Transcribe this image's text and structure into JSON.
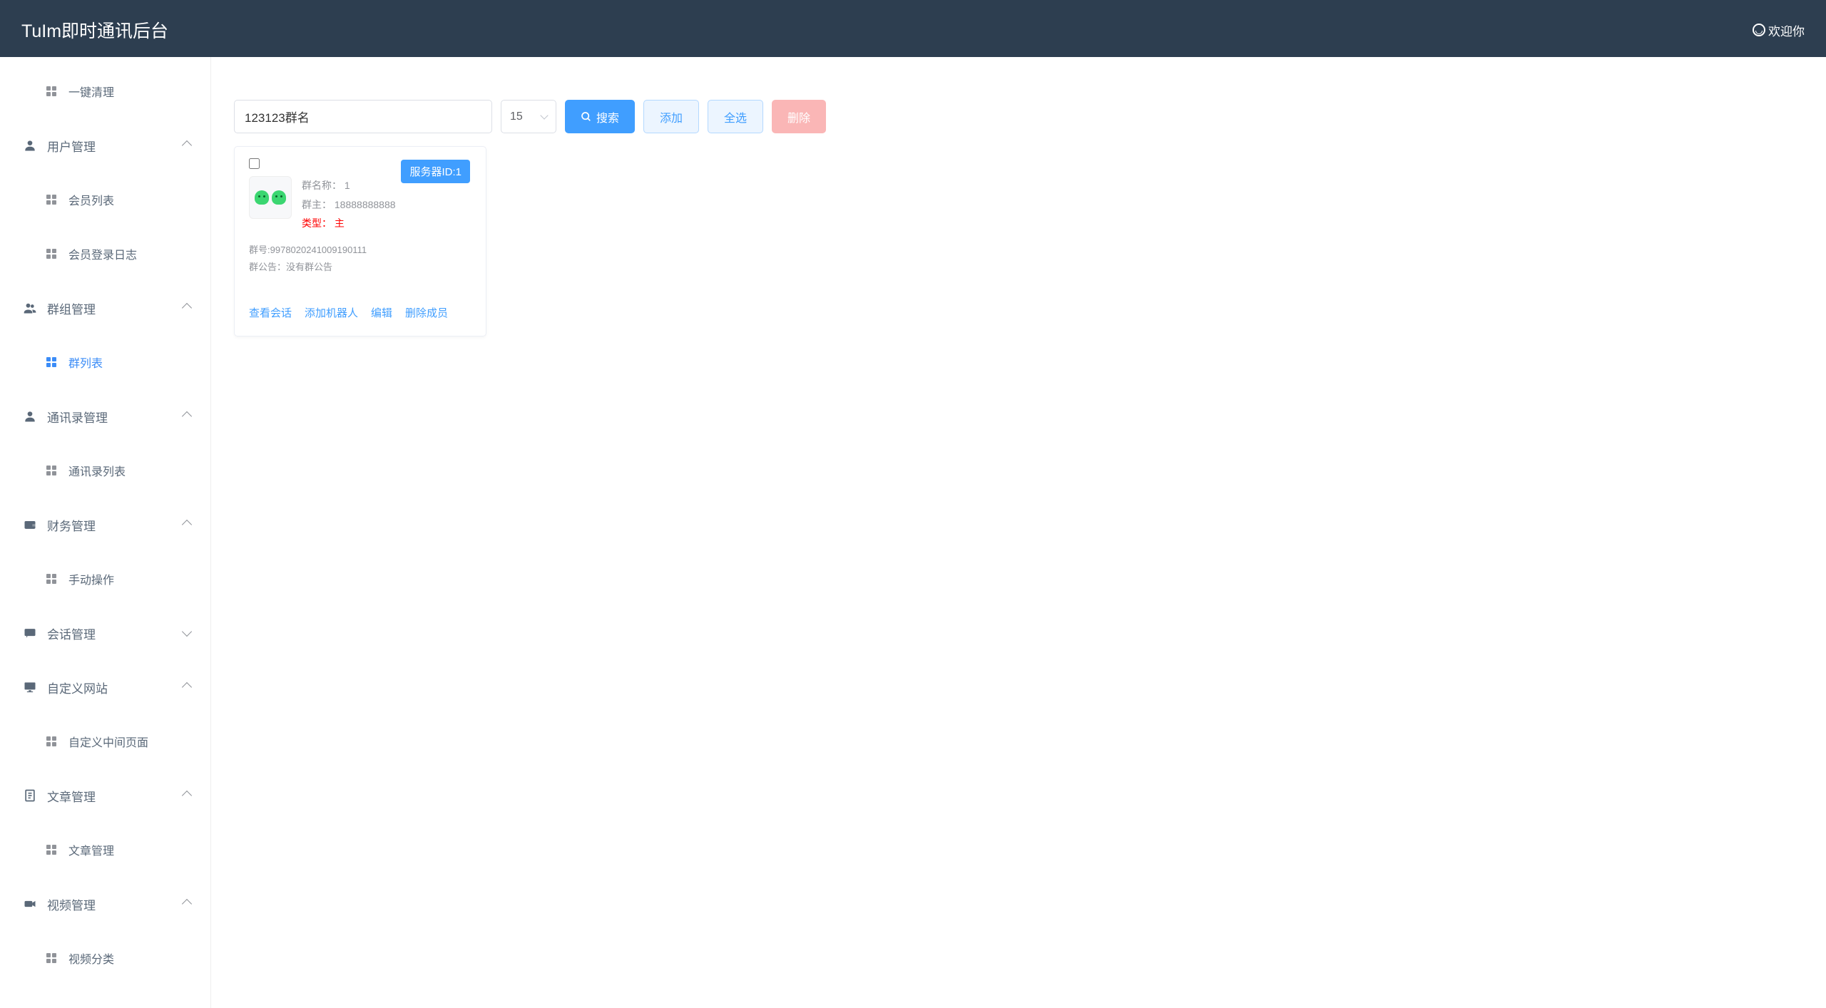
{
  "header": {
    "title": "TuIm即时通讯后台",
    "welcome": "欢迎你"
  },
  "sidebar": {
    "items": [
      {
        "label": "一键清理",
        "type": "sub",
        "icon": "grid"
      },
      {
        "label": "用户管理",
        "type": "group",
        "icon": "user",
        "chevron": "up"
      },
      {
        "label": "会员列表",
        "type": "sub",
        "icon": "grid"
      },
      {
        "label": "会员登录日志",
        "type": "sub",
        "icon": "grid"
      },
      {
        "label": "群组管理",
        "type": "group",
        "icon": "users",
        "chevron": "up"
      },
      {
        "label": "群列表",
        "type": "sub",
        "icon": "grid",
        "active": true
      },
      {
        "label": "通讯录管理",
        "type": "group",
        "icon": "user",
        "chevron": "up"
      },
      {
        "label": "通讯录列表",
        "type": "sub",
        "icon": "grid"
      },
      {
        "label": "财务管理",
        "type": "group",
        "icon": "wallet",
        "chevron": "up"
      },
      {
        "label": "手动操作",
        "type": "sub",
        "icon": "grid"
      },
      {
        "label": "会话管理",
        "type": "group",
        "icon": "chat",
        "chevron": "down"
      },
      {
        "label": "自定义网站",
        "type": "group",
        "icon": "monitor",
        "chevron": "up"
      },
      {
        "label": "自定义中间页面",
        "type": "sub",
        "icon": "grid"
      },
      {
        "label": "文章管理",
        "type": "group",
        "icon": "doc",
        "chevron": "up"
      },
      {
        "label": "文章管理",
        "type": "sub",
        "icon": "grid"
      },
      {
        "label": "视频管理",
        "type": "group",
        "icon": "camera",
        "chevron": "up"
      },
      {
        "label": "视频分类",
        "type": "sub",
        "icon": "grid"
      }
    ]
  },
  "toolbar": {
    "search_value": "123123群名",
    "page_size": "15",
    "search_label": "搜索",
    "add_label": "添加",
    "select_all_label": "全选",
    "delete_label": "删除"
  },
  "card": {
    "badge": "服务器ID:1",
    "name_label": "群名称：",
    "name_value": "1",
    "owner_label": "群主：",
    "owner_value": "18888888888",
    "type_label": "类型：",
    "type_value": "主",
    "group_id_label": "群号:",
    "group_id_value": "9978020241009190111",
    "notice_label": "群公告：",
    "notice_value": "没有群公告",
    "actions": {
      "view_chat": "查看会话",
      "add_bot": "添加机器人",
      "edit": "编辑",
      "remove_member": "删除成员"
    }
  }
}
